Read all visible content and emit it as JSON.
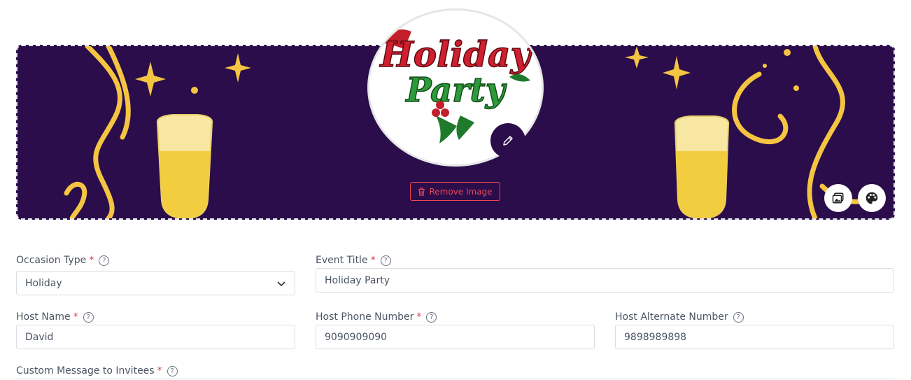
{
  "banner": {
    "remove_image_label": "Remove Image",
    "icons": {
      "edit": "pencil-icon",
      "trash": "trash-icon",
      "change_background": "image-icon",
      "theme": "palette-icon"
    },
    "colors": {
      "background": "#2a0d4a",
      "accent_gold": "#f5c542",
      "danger": "#f04452"
    }
  },
  "event_image": {
    "line1": "Holiday",
    "line2": "Party"
  },
  "form": {
    "occasion_type": {
      "label": "Occasion Type",
      "value": "Holiday"
    },
    "event_title": {
      "label": "Event Title",
      "value": "Holiday Party"
    },
    "host_name": {
      "label": "Host Name",
      "value": "David"
    },
    "host_phone": {
      "label": "Host Phone Number",
      "value": "9090909090"
    },
    "host_alternate": {
      "label": "Host Alternate Number",
      "value": "9898989898"
    },
    "custom_message": {
      "label": "Custom Message to Invitees"
    },
    "required_mark": "*",
    "help_glyph": "?"
  }
}
